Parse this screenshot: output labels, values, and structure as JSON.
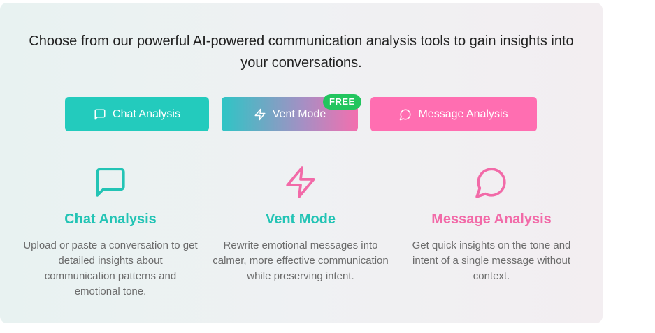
{
  "intro": {
    "text": "Choose from our powerful AI-powered communication analysis tools to gain insights into your conversations."
  },
  "buttons": {
    "chat_label": "Chat Analysis",
    "vent_label": "Vent Mode",
    "vent_badge": "FREE",
    "message_label": "Message Analysis"
  },
  "features": [
    {
      "title": "Chat Analysis",
      "description": "Upload or paste a conversation to get detailed insights about communication patterns and emotional tone.",
      "icon": "message-square-icon",
      "color": "#23c4b5"
    },
    {
      "title": "Vent Mode",
      "description": "Rewrite emotional messages into calmer, more effective communication while preserving intent.",
      "icon": "zap-icon",
      "color": "#f26aa8"
    },
    {
      "title": "Message Analysis",
      "description": "Get quick insights on the tone and intent of a single message without context.",
      "icon": "message-circle-icon",
      "color": "#f26aa8"
    }
  ],
  "colors": {
    "teal": "#23cbbd",
    "pink": "#ff6eb1",
    "badge_green": "#22c55e"
  }
}
